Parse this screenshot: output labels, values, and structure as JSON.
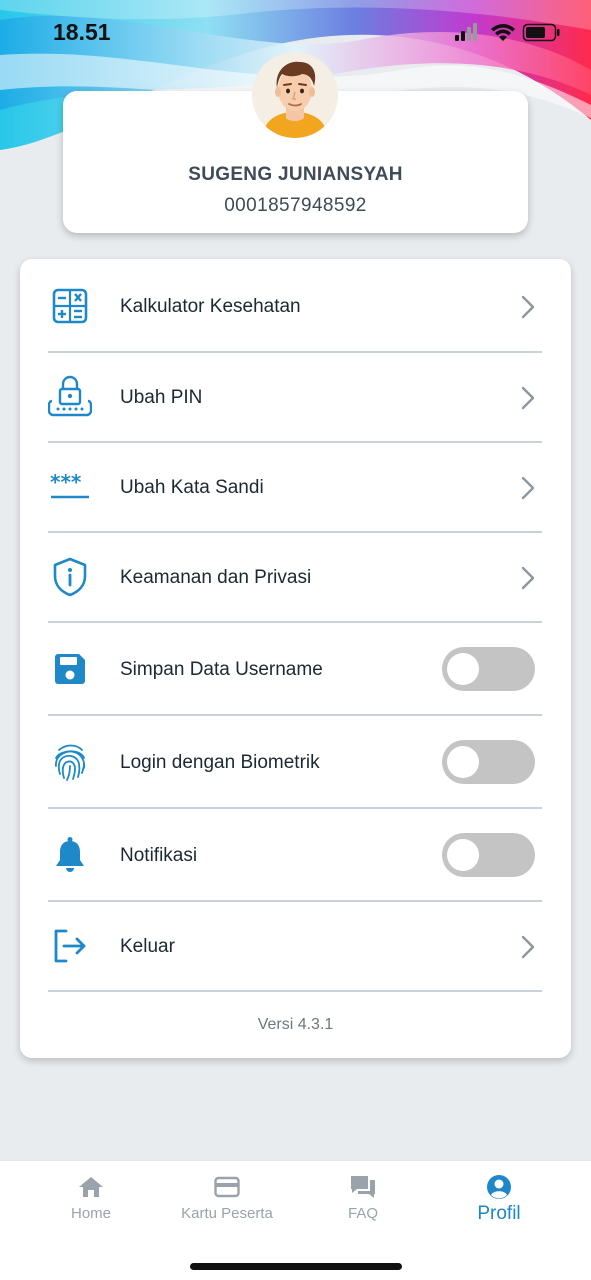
{
  "status_bar": {
    "time": "18.51"
  },
  "profile": {
    "name": "SUGENG JUNIANSYAH",
    "number": "0001857948592",
    "avatar_icon": "avatar-man"
  },
  "menu": {
    "items": [
      {
        "label": "Kalkulator Kesehatan",
        "icon": "calculator-icon",
        "control": "chevron"
      },
      {
        "label": "Ubah PIN",
        "icon": "lock-keypad-icon",
        "control": "chevron"
      },
      {
        "label": "Ubah Kata Sandi",
        "icon": "password-icon",
        "control": "chevron"
      },
      {
        "label": "Keamanan dan Privasi",
        "icon": "shield-info-icon",
        "control": "chevron"
      },
      {
        "label": "Simpan Data Username",
        "icon": "floppy-disk-icon",
        "control": "toggle",
        "on": false
      },
      {
        "label": "Login dengan Biometrik",
        "icon": "fingerprint-icon",
        "control": "toggle",
        "on": false
      },
      {
        "label": "Notifikasi",
        "icon": "bell-icon",
        "control": "toggle",
        "on": false
      },
      {
        "label": "Keluar",
        "icon": "logout-icon",
        "control": "chevron"
      }
    ],
    "version": "Versi 4.3.1"
  },
  "nav": {
    "items": [
      {
        "label": "Home",
        "icon": "home-icon",
        "active": false
      },
      {
        "label": "Kartu Peserta",
        "icon": "card-icon",
        "active": false
      },
      {
        "label": "FAQ",
        "icon": "chat-icon",
        "active": false
      },
      {
        "label": "Profil",
        "icon": "user-circle-icon",
        "active": true
      }
    ]
  },
  "colors": {
    "accent": "#1d87c9",
    "icon": "#1e88c8",
    "toggle_off": "#c4c4c4",
    "background": "#e9ecef"
  }
}
